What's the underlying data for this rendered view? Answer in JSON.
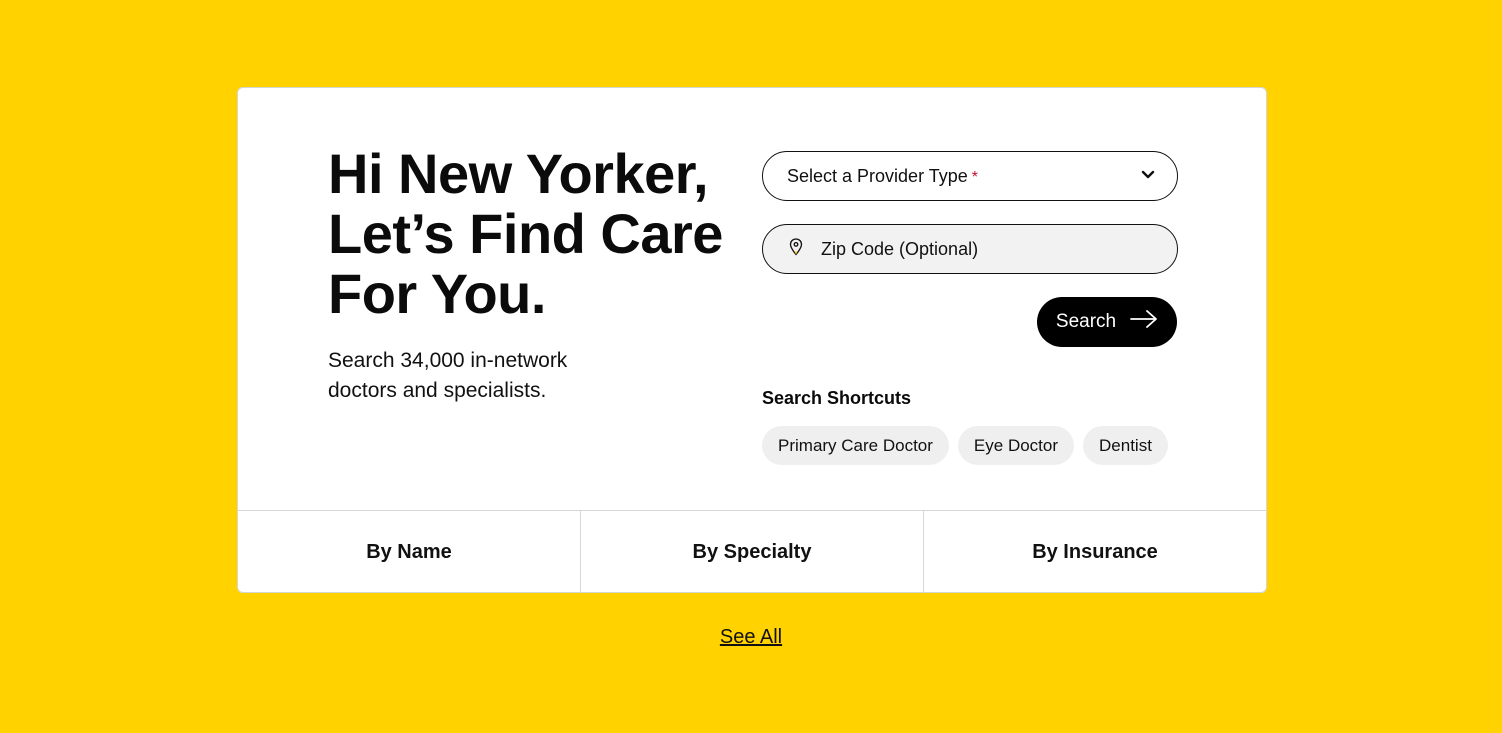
{
  "hero": {
    "headline_line1": "Hi New Yorker,",
    "headline_line2": "Let’s Find Care",
    "headline_line3": "For You.",
    "subtitle": "Search 34,000 in-network doctors and specialists."
  },
  "search_form": {
    "provider_type": {
      "label": "Select a Provider Type",
      "required_mark": "*",
      "icon": "chevron-down-icon"
    },
    "zip": {
      "placeholder": "Zip Code (Optional)",
      "value": "",
      "icon": "location-pin-icon"
    },
    "search_button": {
      "label": "Search",
      "icon": "arrow-right-icon"
    }
  },
  "shortcuts": {
    "heading": "Search Shortcuts",
    "items": [
      "Primary Care Doctor",
      "Eye Doctor",
      "Dentist"
    ]
  },
  "tabs": [
    "By Name",
    "By Specialty",
    "By Insurance"
  ],
  "see_all": "See All",
  "colors": {
    "background": "#FFD200",
    "card": "#FFFFFF",
    "button": "#000000",
    "required": "#C8102E",
    "chip": "#EFEFEF"
  }
}
